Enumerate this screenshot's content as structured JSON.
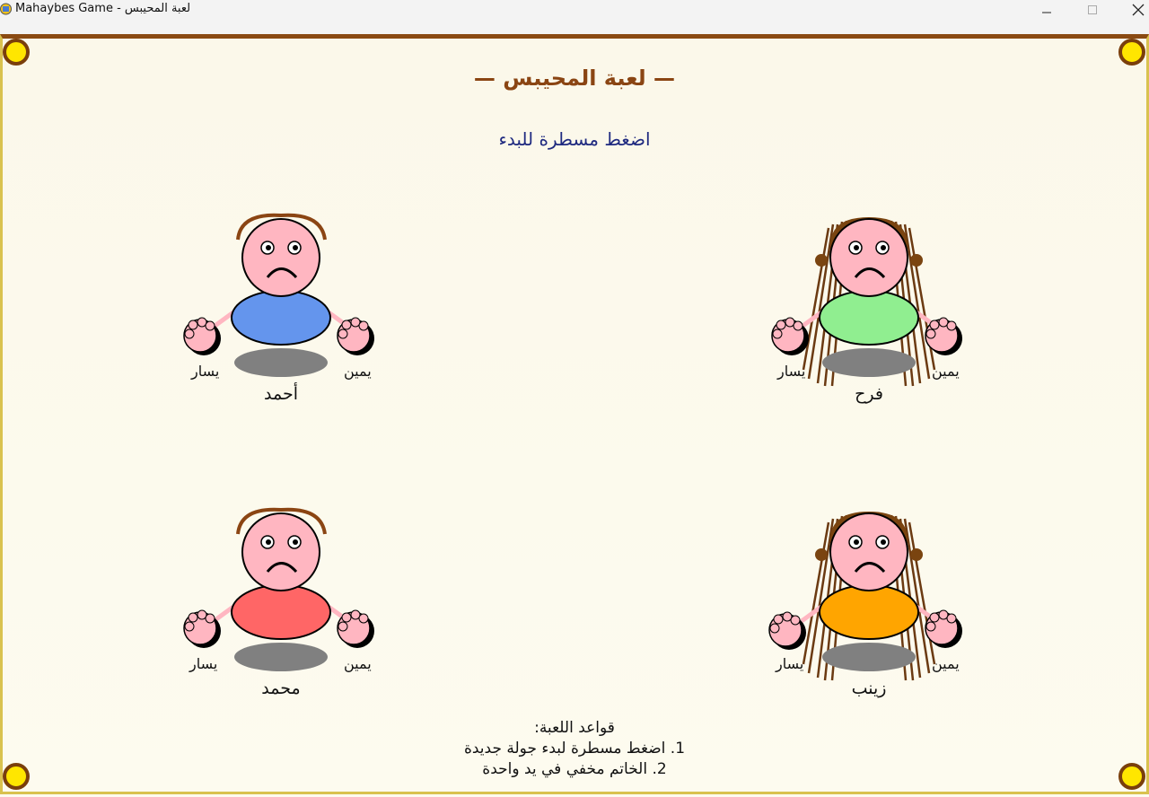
{
  "window": {
    "title": "لعبة المحيبس - Mahaybes Game",
    "controls": [
      "minimize",
      "maximize",
      "close"
    ]
  },
  "game": {
    "title": "— لعبة المحيبس —",
    "status": "اضغط مسطرة للبدء"
  },
  "players": [
    {
      "name": "أحمد",
      "left_hand": "يسار",
      "right_hand": "يمين",
      "gender": "boy",
      "shirt_color": "#6495ed"
    },
    {
      "name": "فرح",
      "left_hand": "يسار",
      "right_hand": "يمين",
      "gender": "girl",
      "shirt_color": "#90ee90"
    },
    {
      "name": "محمد",
      "left_hand": "يسار",
      "right_hand": "يمين",
      "gender": "boy",
      "shirt_color": "#ff6666"
    },
    {
      "name": "زينب",
      "left_hand": "يسار",
      "right_hand": "يمين",
      "gender": "girl",
      "shirt_color": "#ffa500"
    }
  ],
  "rules": {
    "heading": "قواعد اللعبة:",
    "items": [
      "1. اضغط مسطرة لبدء جولة جديدة",
      "2. الخاتم مخفي في يد واحدة"
    ]
  },
  "colors": {
    "board_background": "#fdfbef",
    "board_border_top": "#8a4a12",
    "corner_fill": "#ffe600",
    "title_color": "#8a4513",
    "status_color": "#1f2a80",
    "face_color": "#ffb6c1",
    "shadow_color": "#808080",
    "hair_color": "#8b4513"
  }
}
